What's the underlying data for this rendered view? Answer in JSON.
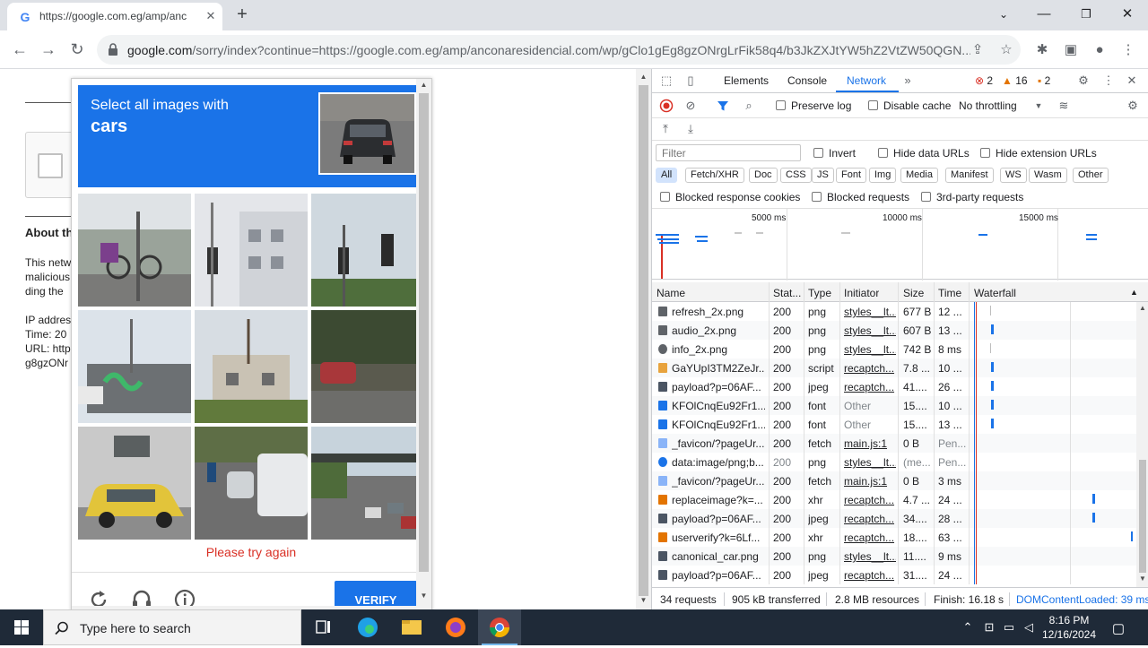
{
  "browser": {
    "tab_title": "https://google.com.eg/amp/anc",
    "tab_favicon": "G",
    "url_domain": "google.com",
    "url_path": "/sorry/index?continue=https://google.com.eg/amp/anconaresidencial.com/wp/gClo1gEg8gzONrgLrFik58q4/b3JkZXJtYW5hZ2VtZW50QGN..."
  },
  "page": {
    "about_heading": "About th",
    "lines": [
      "This netw",
      "malicious",
      "ding the"
    ],
    "ip_lines": [
      "IP addres",
      "Time: 20",
      "URL: http",
      "g8gzONr"
    ]
  },
  "captcha": {
    "prompt_line1": "Select all images with",
    "prompt_line2": "cars",
    "error_text": "Please try again",
    "verify_label": "VERIFY"
  },
  "devtools": {
    "tabs": [
      "Elements",
      "Console",
      "Network"
    ],
    "active_tab": "Network",
    "errors": "2",
    "warnings": "16",
    "issues": "2",
    "preserve_log": "Preserve log",
    "disable_cache": "Disable cache",
    "throttling": "No throttling",
    "filter_placeholder": "Filter",
    "invert": "Invert",
    "hide_data_urls": "Hide data URLs",
    "hide_ext_urls": "Hide extension URLs",
    "type_filters": [
      "All",
      "Fetch/XHR",
      "Doc",
      "CSS",
      "JS",
      "Font",
      "Img",
      "Media",
      "Manifest",
      "WS",
      "Wasm",
      "Other"
    ],
    "blocked_cookies": "Blocked response cookies",
    "blocked_requests": "Blocked requests",
    "third_party": "3rd-party requests",
    "overview_labels": [
      "5000 ms",
      "10000 ms",
      "15000 ms"
    ],
    "columns": [
      "Name",
      "Stat...",
      "Type",
      "Initiator",
      "Size",
      "Time",
      "Waterfall"
    ],
    "rows": [
      {
        "name": "refresh_2x.png",
        "status": "200",
        "type": "png",
        "initiator": "styles__lt...",
        "size": "677 B",
        "time": "12 ...",
        "icon": "refresh-icon"
      },
      {
        "name": "audio_2x.png",
        "status": "200",
        "type": "png",
        "initiator": "styles__lt...",
        "size": "607 B",
        "time": "13 ...",
        "icon": "headphones-icon"
      },
      {
        "name": "info_2x.png",
        "status": "200",
        "type": "png",
        "initiator": "styles__lt...",
        "size": "742 B",
        "time": "8 ms",
        "icon": "info-icon"
      },
      {
        "name": "GaYUpI3TM2ZeJr...",
        "status": "200",
        "type": "script",
        "initiator": "recaptch...",
        "size": "7.8 ...",
        "time": "10 ...",
        "icon": "script-icon"
      },
      {
        "name": "payload?p=06AF...",
        "status": "200",
        "type": "jpeg",
        "initiator": "recaptch...",
        "size": "41....",
        "time": "26 ...",
        "icon": "image-icon"
      },
      {
        "name": "KFOlCnqEu92Fr1...",
        "status": "200",
        "type": "font",
        "initiator": "Other",
        "size": "15....",
        "time": "10 ...",
        "icon": "font-icon"
      },
      {
        "name": "KFOlCnqEu92Fr1...",
        "status": "200",
        "type": "font",
        "initiator": "Other",
        "size": "15....",
        "time": "13 ...",
        "icon": "font-icon"
      },
      {
        "name": "_favicon/?pageUr...",
        "status": "200",
        "type": "fetch",
        "initiator": "main.js:1",
        "size": "0 B",
        "time": "Pen...",
        "icon": "document-icon"
      },
      {
        "name": "data:image/png;b...",
        "status": "200",
        "type": "png",
        "initiator": "styles__lt...",
        "size": "(me...",
        "time": "Pen...",
        "icon": "data-icon"
      },
      {
        "name": "_favicon/?pageUr...",
        "status": "200",
        "type": "fetch",
        "initiator": "main.js:1",
        "size": "0 B",
        "time": "3 ms",
        "icon": "document-icon"
      },
      {
        "name": "replaceimage?k=...",
        "status": "200",
        "type": "xhr",
        "initiator": "recaptch...",
        "size": "4.7 ...",
        "time": "24 ...",
        "icon": "xhr-icon"
      },
      {
        "name": "payload?p=06AF...",
        "status": "200",
        "type": "jpeg",
        "initiator": "recaptch...",
        "size": "34....",
        "time": "28 ...",
        "icon": "image-icon"
      },
      {
        "name": "userverify?k=6Lf...",
        "status": "200",
        "type": "xhr",
        "initiator": "recaptch...",
        "size": "18....",
        "time": "63 ...",
        "icon": "xhr-icon"
      },
      {
        "name": "canonical_car.png",
        "status": "200",
        "type": "png",
        "initiator": "styles__lt...",
        "size": "11....",
        "time": "9 ms",
        "icon": "image-icon"
      },
      {
        "name": "payload?p=06AF...",
        "status": "200",
        "type": "jpeg",
        "initiator": "recaptch...",
        "size": "31....",
        "time": "24 ...",
        "icon": "image-icon"
      }
    ],
    "status": {
      "requests": "34 requests",
      "transferred": "905 kB transferred",
      "resources": "2.8 MB resources",
      "finish": "Finish: 16.18 s",
      "dcl": "DOMContentLoaded: 39 ms"
    }
  },
  "taskbar": {
    "search_placeholder": "Type here to search",
    "time": "8:16 PM",
    "date": "12/16/2024"
  },
  "colors": {
    "accent": "#1a73e8",
    "error": "#d93025",
    "taskbar": "#1f2a38"
  }
}
